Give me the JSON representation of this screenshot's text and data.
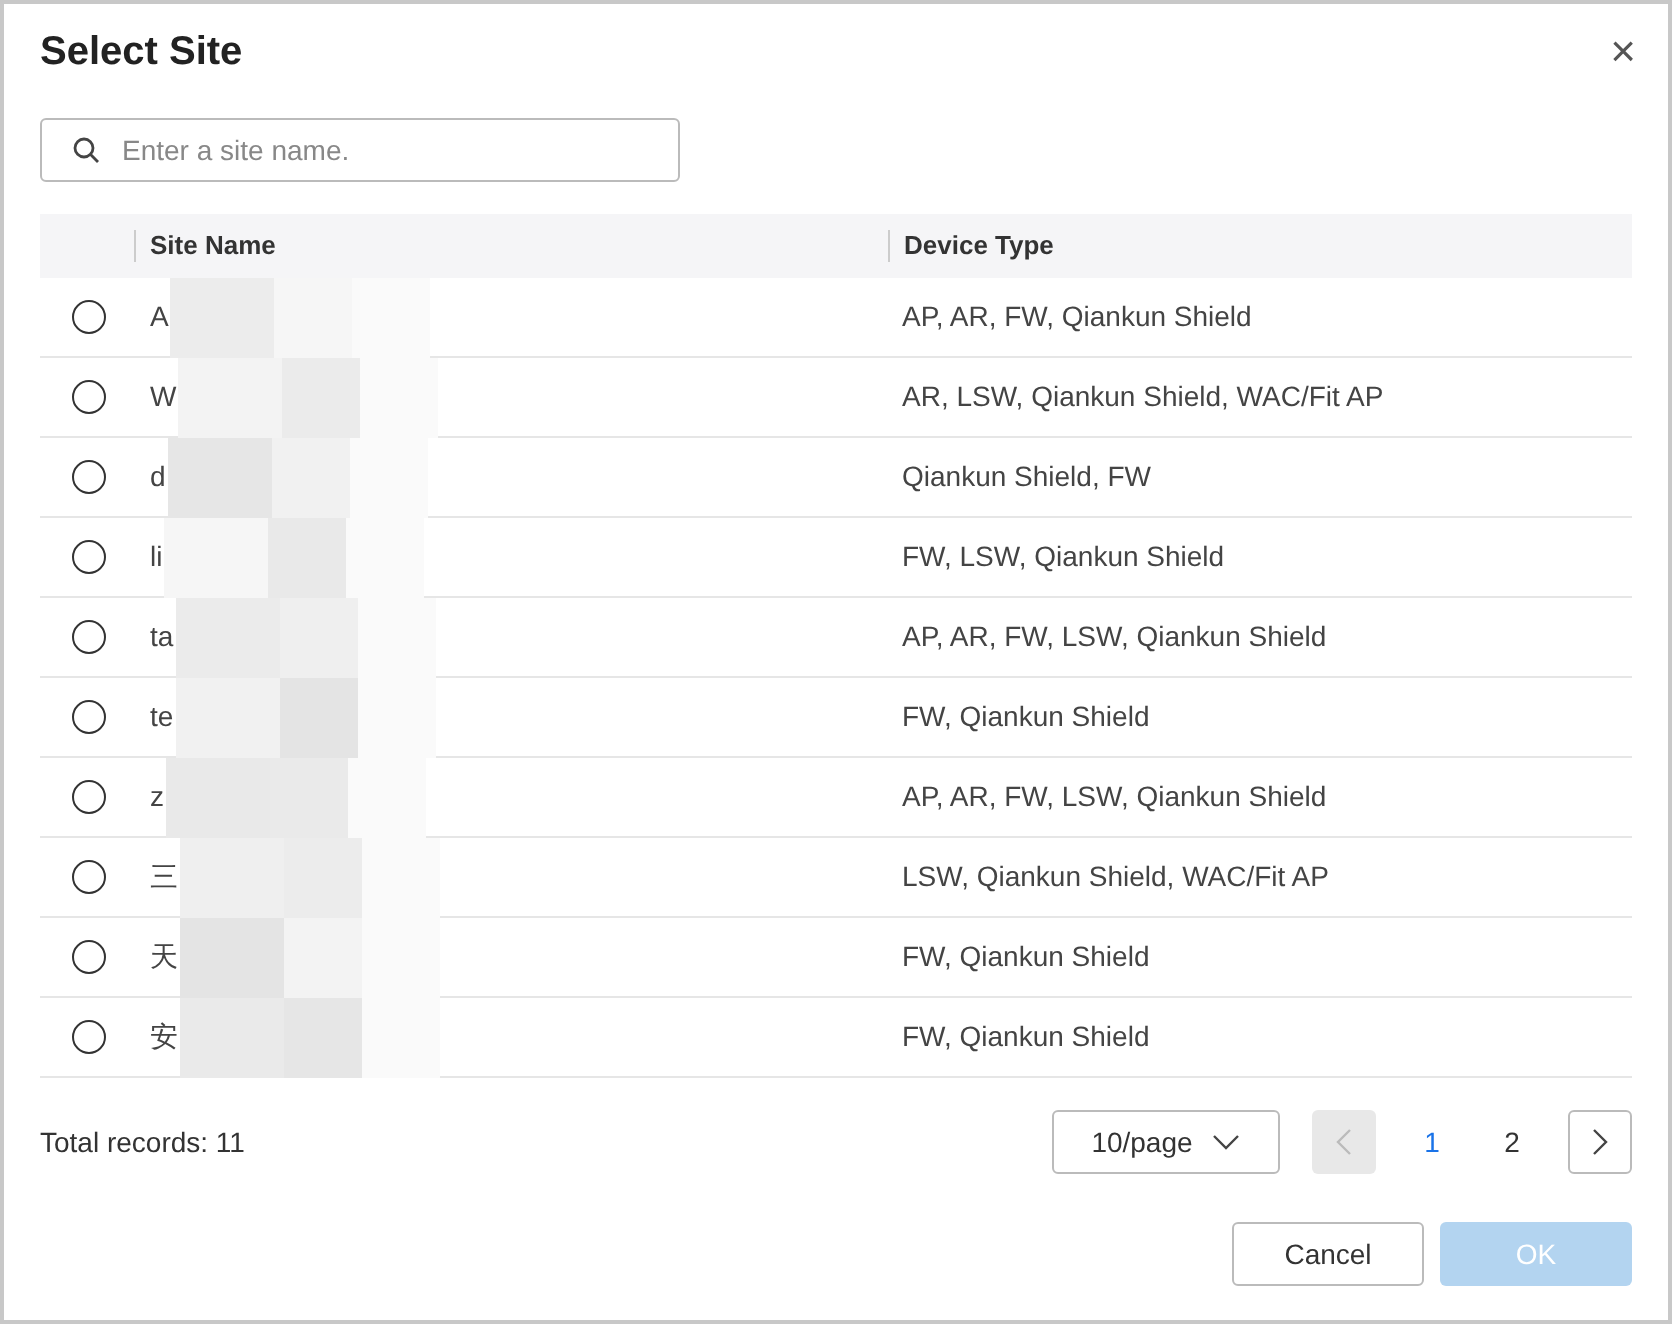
{
  "dialog": {
    "title": "Select Site",
    "close": "×"
  },
  "search": {
    "placeholder": "Enter a site name."
  },
  "table": {
    "columns": [
      "Site Name",
      "Device Type"
    ],
    "rows": [
      {
        "site_name": "A",
        "device_type": "AP, AR, FW, Qiankun Shield",
        "selected": false
      },
      {
        "site_name": "W",
        "device_type": "AR, LSW, Qiankun Shield, WAC/Fit AP",
        "selected": false
      },
      {
        "site_name": "d",
        "device_type": "Qiankun Shield, FW",
        "selected": false
      },
      {
        "site_name": "li",
        "device_type": "FW, LSW, Qiankun Shield",
        "selected": false
      },
      {
        "site_name": "ta",
        "device_type": "AP, AR, FW, LSW, Qiankun Shield",
        "selected": false
      },
      {
        "site_name": "te",
        "device_type": "FW, Qiankun Shield",
        "selected": false
      },
      {
        "site_name": "z",
        "device_type": "AP, AR, FW, LSW, Qiankun Shield",
        "selected": false
      },
      {
        "site_name": "三",
        "device_type": "LSW, Qiankun Shield, WAC/Fit AP",
        "selected": false
      },
      {
        "site_name": "天",
        "device_type": "FW, Qiankun Shield",
        "selected": false
      },
      {
        "site_name": "安",
        "device_type": "FW, Qiankun Shield",
        "selected": false
      }
    ]
  },
  "footer": {
    "total": "Total records: 11",
    "page_size": "10/page",
    "pages": [
      {
        "label": "1",
        "selected": true
      },
      {
        "label": "2",
        "selected": false
      }
    ],
    "prev_disabled": true,
    "next_disabled": false
  },
  "buttons": [
    {
      "label": "Cancel",
      "kind": "secondary",
      "disabled": false
    },
    {
      "label": "OK",
      "kind": "primary",
      "disabled": true
    }
  ]
}
